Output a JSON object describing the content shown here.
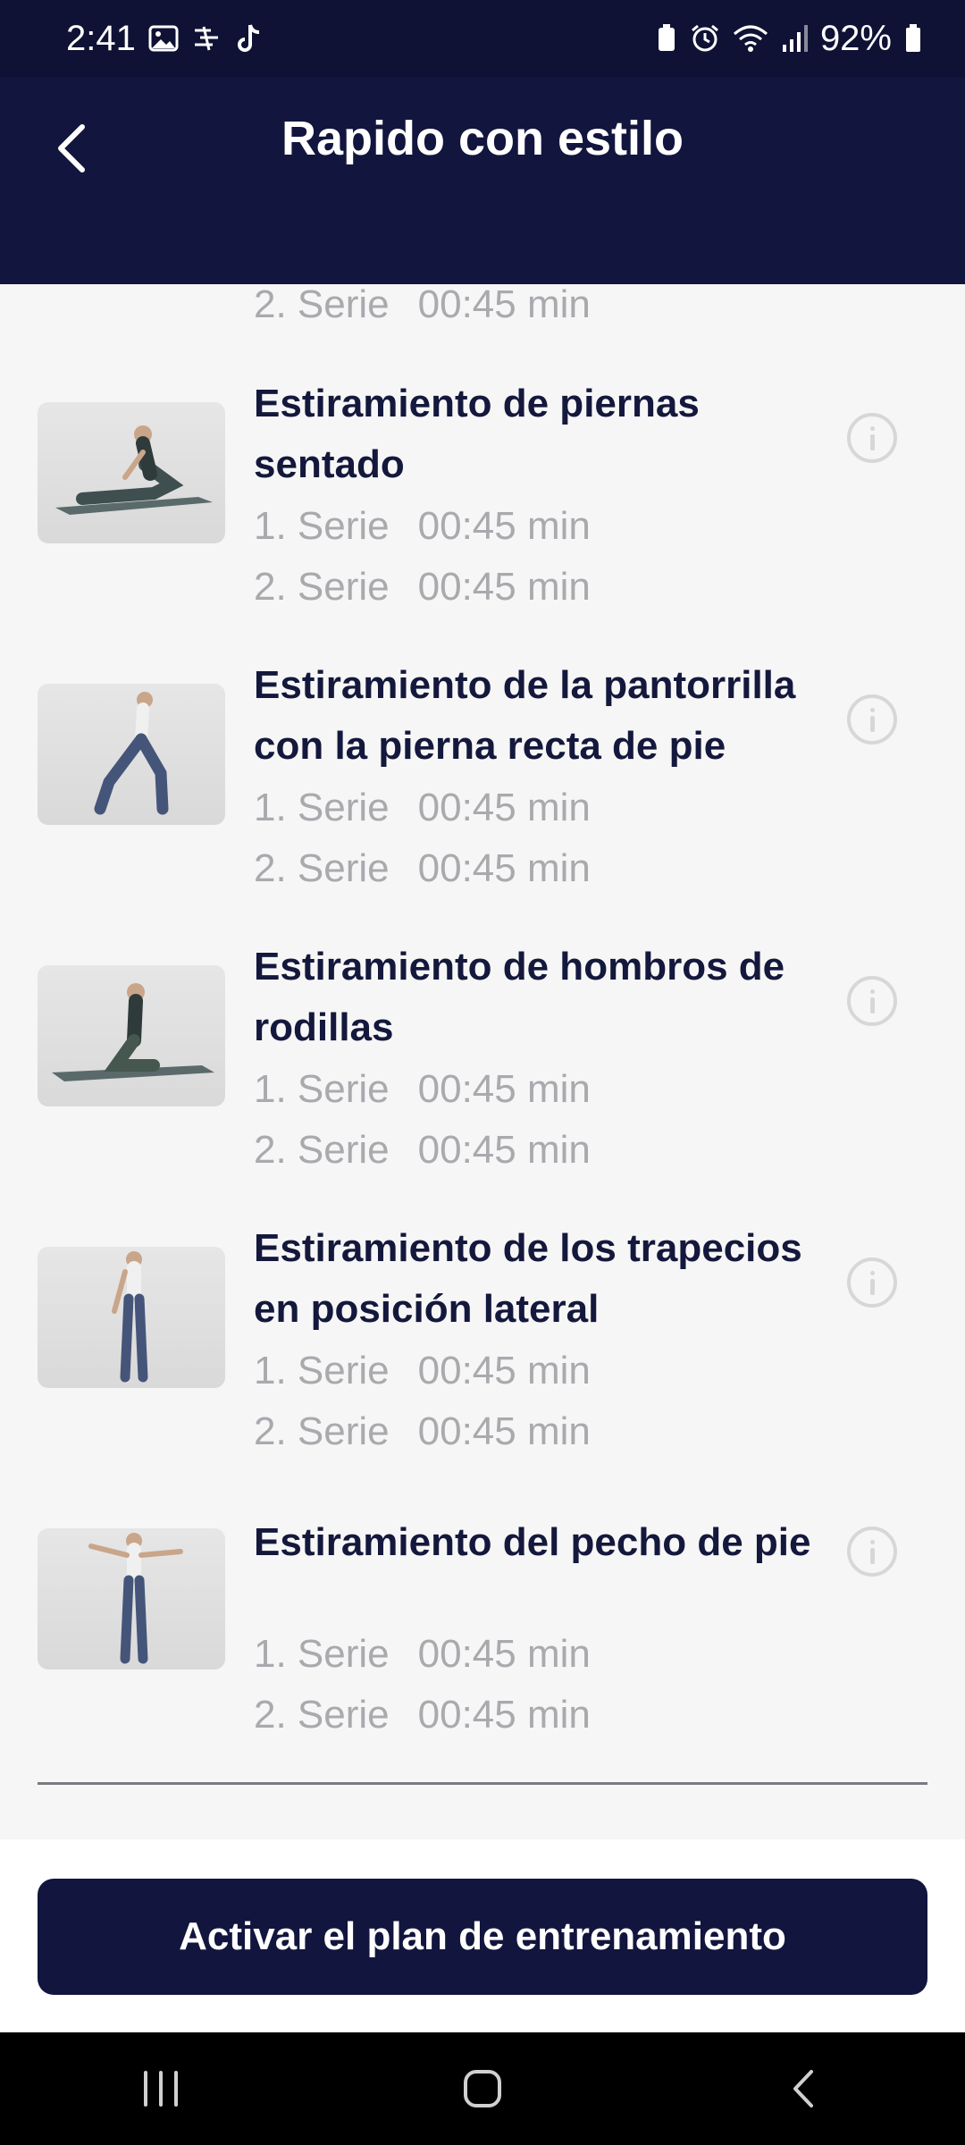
{
  "status": {
    "time": "2:41",
    "battery": "92%"
  },
  "header": {
    "title": "Rapido con estilo"
  },
  "top_partial": {
    "label": "2. Serie",
    "duration": "00:45 min"
  },
  "exercises": [
    {
      "title_line1": "Estiramiento de piernas",
      "title_line2": "sentado",
      "series": [
        {
          "label": "1. Serie",
          "duration": "00:45 min"
        },
        {
          "label": "2. Serie",
          "duration": "00:45 min"
        }
      ]
    },
    {
      "title_line1": "Estiramiento de la pantorrilla",
      "title_line2": "con la pierna recta de pie",
      "series": [
        {
          "label": "1. Serie",
          "duration": "00:45 min"
        },
        {
          "label": "2. Serie",
          "duration": "00:45 min"
        }
      ]
    },
    {
      "title_line1": "Estiramiento de hombros de",
      "title_line2": "rodillas",
      "series": [
        {
          "label": "1. Serie",
          "duration": "00:45 min"
        },
        {
          "label": "2. Serie",
          "duration": "00:45 min"
        }
      ]
    },
    {
      "title_line1": "Estiramiento de los trapecios",
      "title_line2": "en posición lateral",
      "series": [
        {
          "label": "1. Serie",
          "duration": "00:45 min"
        },
        {
          "label": "2. Serie",
          "duration": "00:45 min"
        }
      ]
    },
    {
      "title_line1": "Estiramiento del pecho de pie",
      "title_line2": "",
      "series": [
        {
          "label": "1. Serie",
          "duration": "00:45 min"
        },
        {
          "label": "2. Serie",
          "duration": "00:45 min"
        }
      ]
    }
  ],
  "footer": {
    "activate_label": "Activar el plan de entrenamiento"
  },
  "colors": {
    "navy": "#12153d",
    "muted_text": "#a9a9ae",
    "title_text": "#14183c"
  }
}
